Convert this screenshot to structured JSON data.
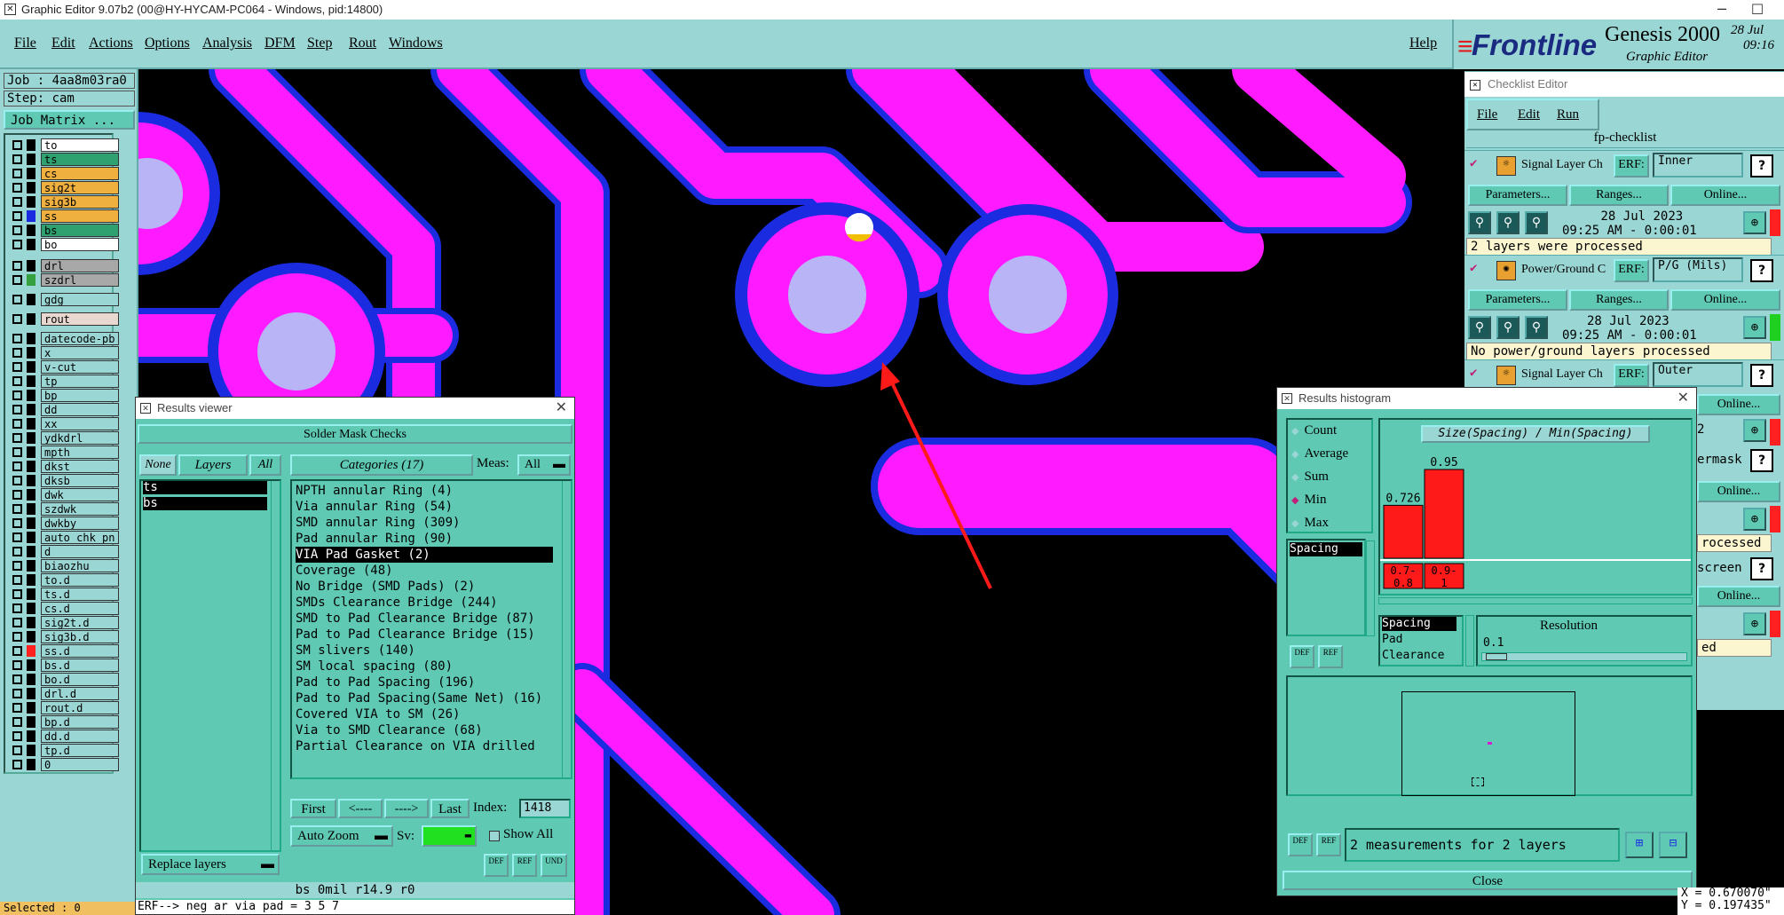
{
  "window": {
    "title": "Graphic Editor 9.07b2 (00@HY-HYCAM-PC064 - Windows, pid:14800)",
    "minimize": "─",
    "maximize": "☐"
  },
  "menu": {
    "file": "File",
    "edit": "Edit",
    "actions": "Actions",
    "options": "Options",
    "analysis": "Analysis",
    "dfm": "DFM",
    "step": "Step",
    "rout": "Rout",
    "windows": "Windows",
    "help": "Help"
  },
  "logo": {
    "brand": "Frontline",
    "product": "Genesis 2000",
    "subtitle": "Graphic Editor",
    "date": "28 Jul",
    "time": "09:16"
  },
  "job": {
    "job_line": "Job : 4aa8m03ra0",
    "step_line": "Step: cam",
    "matrix_button": "Job Matrix ..."
  },
  "layers": [
    {
      "name": "to",
      "color": "#ffffff",
      "sw": "#000000"
    },
    {
      "name": "ts",
      "color": "#2fa070",
      "sw": "#000000"
    },
    {
      "name": "cs",
      "color": "#f0b040",
      "sw": "#000000"
    },
    {
      "name": "sig2t",
      "color": "#f0b040",
      "sw": "#000000"
    },
    {
      "name": "sig3b",
      "color": "#f0b040",
      "sw": "#000000"
    },
    {
      "name": "ss",
      "color": "#f0b040",
      "sw": "#1a2be0"
    },
    {
      "name": "bs",
      "color": "#2fa070",
      "sw": "#000000"
    },
    {
      "name": "bo",
      "color": "#ffffff",
      "sw": "#000000"
    },
    {
      "name": "drl",
      "color": "#a8a8a8",
      "sw": "#000000"
    },
    {
      "name": "szdrl",
      "color": "#a8a8a8",
      "sw": "#34a040"
    },
    {
      "name": "gdg",
      "color": "#9ad6d4",
      "sw": "#000000"
    },
    {
      "name": "rout",
      "color": "#e8d8d0",
      "sw": "#000000"
    },
    {
      "name": "datecode-pb",
      "color": "#9ad6d4",
      "sw": "#000000"
    },
    {
      "name": "x",
      "color": "#9ad6d4",
      "sw": "#000000"
    },
    {
      "name": "v-cut",
      "color": "#9ad6d4",
      "sw": "#000000"
    },
    {
      "name": "tp",
      "color": "#9ad6d4",
      "sw": "#000000"
    },
    {
      "name": "bp",
      "color": "#9ad6d4",
      "sw": "#000000"
    },
    {
      "name": "dd",
      "color": "#9ad6d4",
      "sw": "#000000"
    },
    {
      "name": "xx",
      "color": "#9ad6d4",
      "sw": "#000000"
    },
    {
      "name": "ydkdrl",
      "color": "#9ad6d4",
      "sw": "#000000"
    },
    {
      "name": "mpth",
      "color": "#9ad6d4",
      "sw": "#000000"
    },
    {
      "name": "dkst",
      "color": "#9ad6d4",
      "sw": "#000000"
    },
    {
      "name": "dksb",
      "color": "#9ad6d4",
      "sw": "#000000"
    },
    {
      "name": "dwk",
      "color": "#9ad6d4",
      "sw": "#000000"
    },
    {
      "name": "szdwk",
      "color": "#9ad6d4",
      "sw": "#000000"
    },
    {
      "name": "dwkby",
      "color": "#9ad6d4",
      "sw": "#000000"
    },
    {
      "name": "auto_chk_pn",
      "color": "#9ad6d4",
      "sw": "#000000"
    },
    {
      "name": "d",
      "color": "#9ad6d4",
      "sw": "#000000"
    },
    {
      "name": "biaozhu",
      "color": "#9ad6d4",
      "sw": "#000000"
    },
    {
      "name": "to.d",
      "color": "#9ad6d4",
      "sw": "#000000"
    },
    {
      "name": "ts.d",
      "color": "#9ad6d4",
      "sw": "#000000"
    },
    {
      "name": "cs.d",
      "color": "#9ad6d4",
      "sw": "#000000"
    },
    {
      "name": "sig2t.d",
      "color": "#9ad6d4",
      "sw": "#000000"
    },
    {
      "name": "sig3b.d",
      "color": "#9ad6d4",
      "sw": "#000000"
    },
    {
      "name": "ss.d",
      "color": "#9ad6d4",
      "sw": "#ff2020"
    },
    {
      "name": "bs.d",
      "color": "#9ad6d4",
      "sw": "#000000"
    },
    {
      "name": "bo.d",
      "color": "#9ad6d4",
      "sw": "#000000"
    },
    {
      "name": "drl.d",
      "color": "#9ad6d4",
      "sw": "#000000"
    },
    {
      "name": "rout.d",
      "color": "#9ad6d4",
      "sw": "#000000"
    },
    {
      "name": "bp.d",
      "color": "#9ad6d4",
      "sw": "#000000"
    },
    {
      "name": "dd.d",
      "color": "#9ad6d4",
      "sw": "#000000"
    },
    {
      "name": "tp.d",
      "color": "#9ad6d4",
      "sw": "#000000"
    },
    {
      "name": "0",
      "color": "#9ad6d4",
      "sw": "#000000"
    }
  ],
  "status": {
    "selected": "Selected : 0",
    "erf": "ERF--> neg ar via pad = 3 5 7",
    "layer_info": "bs 0mil  r14.9  r0",
    "coord_x": "X = 0.670070\"",
    "coord_y": "Y = 0.197435\""
  },
  "results_viewer": {
    "title": "Results viewer",
    "header": "Solder Mask Checks",
    "none_btn": "None",
    "layers_btn": "Layers",
    "all_btn": "All",
    "categories_btn": "Categories (17)",
    "meas_label": "Meas:",
    "meas_value": "All",
    "layer_items": [
      "ts",
      "bs"
    ],
    "categories": [
      "NPTH annular Ring (4)",
      "Via annular Ring (54)",
      "SMD annular Ring (309)",
      "Pad annular Ring (90)",
      "VIA Pad Gasket (2)",
      "Coverage (48)",
      "No Bridge (SMD Pads) (2)",
      "SMDs Clearance Bridge (244)",
      "SMD to Pad Clearance Bridge (87)",
      "Pad to Pad Clearance Bridge (15)",
      "SM slivers (140)",
      "SM local spacing (80)",
      "Pad to Pad Spacing (196)",
      "Pad to Pad Spacing(Same Net) (16)",
      "Covered VIA to SM (26)",
      "Via to SMD Clearance (68)",
      "Partial Clearance on VIA drilled"
    ],
    "first_btn": "First",
    "prev_btn": "<----",
    "next_btn": "---->",
    "last_btn": "Last",
    "index_label": "Index:",
    "index_value": "1418",
    "replace_btn": "Replace layers",
    "autozoom_btn": "Auto Zoom",
    "sv_label": "Sv:",
    "showall_label": "Show All",
    "def_btn": "DEF",
    "ref_btn": "REF",
    "und_btn": "UND"
  },
  "checklist": {
    "title": "Checklist Editor",
    "menu_file": "File",
    "menu_edit": "Edit",
    "menu_run": "Run",
    "name": "fp-checklist",
    "rows": [
      {
        "label": "Signal Layer Ch",
        "erf_label": "ERF:",
        "erf_value": "Inner",
        "params": "Parameters...",
        "ranges": "Ranges...",
        "online": "Online...",
        "date": "28 Jul 2023",
        "time": "09:25 AM - 0:00:01",
        "msg": "2 layers were processed",
        "status_color": "#ff2020"
      },
      {
        "label": "Power/Ground C",
        "erf_label": "ERF:",
        "erf_value": "P/G (Mils)",
        "params": "Parameters...",
        "ranges": "Ranges...",
        "online": "Online...",
        "date": "28 Jul 2023",
        "time": "09:25 AM - 0:00:01",
        "msg": "No power/ground layers processed",
        "status_color": "#20d020"
      },
      {
        "label": "Signal Layer Ch",
        "erf_label": "ERF:",
        "erf_value": "Outer"
      }
    ],
    "side": {
      "online1": "Online...",
      "frag1": "2",
      "frag2": "ermask",
      "online2": "Online...",
      "frag3": "rocessed",
      "frag4": "screen",
      "online3": "Online...",
      "frag5": "ed"
    }
  },
  "histogram": {
    "title": "Results histogram",
    "options": [
      "Count",
      "Average",
      "Sum",
      "Min",
      "Max"
    ],
    "selected_option": "Min",
    "measure_items": [
      "Spacing"
    ],
    "chart_title": "Size(Spacing) / Min(Spacing)",
    "resolution_label": "Resolution",
    "resolution_value": "0.1",
    "list_items": [
      "Spacing",
      "Pad",
      "Clearance"
    ],
    "measurements_msg": "2 measurements for 2 layers",
    "close_btn": "Close",
    "def_btn": "DEF",
    "ref_btn": "REF"
  },
  "chart_data": {
    "type": "bar",
    "categories": [
      "0.7-0.8",
      "0.9-1"
    ],
    "values": [
      0.726,
      0.95
    ],
    "value_labels": [
      "0.726",
      "0.95"
    ],
    "title": "Size(Spacing) / Min(Spacing)",
    "ylim": [
      0,
      1
    ],
    "bar_color": "#ff1a1a"
  }
}
